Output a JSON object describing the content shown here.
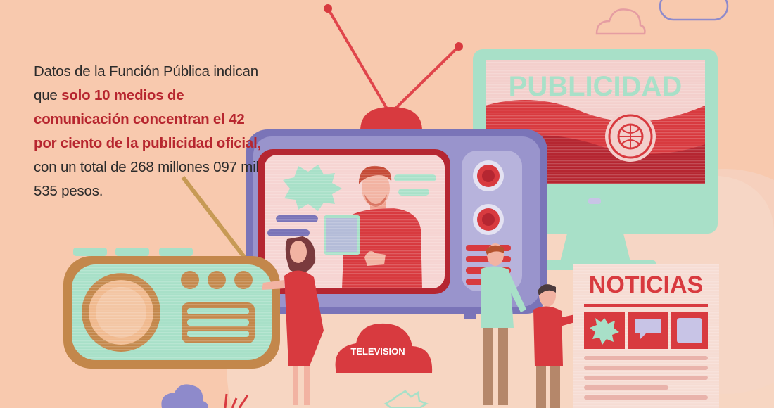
{
  "caption": {
    "part1": "Datos de la Función Pública indican que ",
    "highlight": "solo 10 medios de comunicación concentran el 42 por ciento de la publicidad oficial,",
    "part2": " con un total de 268 millones 097 mil 535 pesos."
  },
  "monitor_sign": "PUBLICIDAD",
  "newspaper_title": "NOTICIAS",
  "cloud_label": "TELEVISION",
  "colors": {
    "background": "#f8c9ae",
    "accent_red": "#d83a3f",
    "highlight_text": "#b7262f",
    "mint": "#a8e0c8",
    "purple": "#7a74b8",
    "lavender": "#b7b3dc"
  }
}
